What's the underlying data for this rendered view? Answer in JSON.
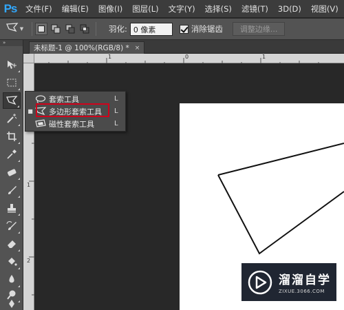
{
  "app": {
    "logo": "Ps"
  },
  "menu": [
    "文件(F)",
    "编辑(E)",
    "图像(I)",
    "图层(L)",
    "文字(Y)",
    "选择(S)",
    "滤镜(T)",
    "3D(D)",
    "视图(V)"
  ],
  "options_bar": {
    "tool_icon": "polygonal-lasso-icon",
    "feather_label": "羽化:",
    "feather_value": "0 像素",
    "antialias_label": "消除锯齿",
    "antialias_checked": true,
    "refine_edge_label": "调整边缘..."
  },
  "document_tab": {
    "title": "未标题-1 @ 100%(RGB/8) *",
    "close": "×"
  },
  "rulers": {
    "horizontal_labels": [
      "1",
      "0",
      "1"
    ],
    "vertical_labels": [
      "1",
      "2"
    ]
  },
  "toolbox": {
    "collapse": "»",
    "tools": [
      "move-tool-icon",
      "marquee-tool-icon",
      "lasso-tool-icon",
      "magic-wand-icon",
      "crop-tool-icon",
      "eyedropper-icon",
      "healing-brush-icon",
      "brush-tool-icon",
      "clone-stamp-icon",
      "history-brush-icon",
      "eraser-icon",
      "paint-bucket-icon",
      "blur-tool-icon",
      "dodge-tool-icon",
      "pen-tool-icon"
    ]
  },
  "flyout": {
    "items": [
      {
        "label": "套索工具",
        "shortcut": "L",
        "icon": "lasso-icon",
        "selected": false
      },
      {
        "label": "多边形套索工具",
        "shortcut": "L",
        "icon": "polygonal-lasso-icon",
        "selected": true
      },
      {
        "label": "磁性套索工具",
        "shortcut": "L",
        "icon": "magnetic-lasso-icon",
        "selected": false
      }
    ],
    "bullet": "■"
  },
  "watermark": {
    "title": "溜溜自学",
    "url": "ZIXUE.3066.COM"
  },
  "colors": {
    "highlight_red": "#d0021b",
    "ps_blue": "#31a8ff",
    "canvas_bg": "#282828"
  }
}
